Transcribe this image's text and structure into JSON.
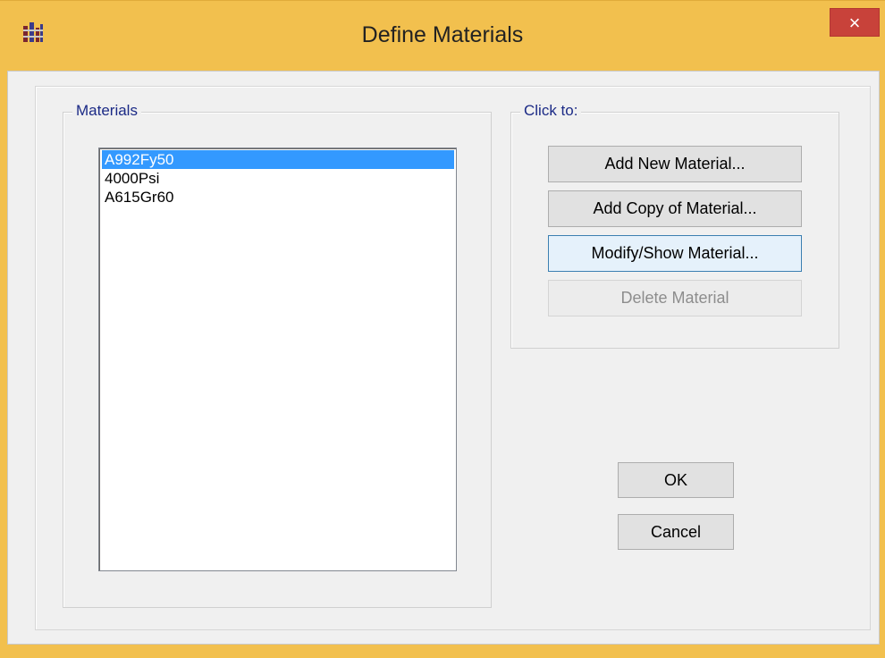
{
  "window": {
    "title": "Define Materials",
    "close_label": "×"
  },
  "materials_group": {
    "legend": "Materials",
    "items": [
      "A992Fy50",
      "4000Psi",
      "A615Gr60"
    ],
    "selected_index": 0
  },
  "actions_group": {
    "legend": "Click to:",
    "add_new": "Add New Material...",
    "add_copy": "Add Copy of Material...",
    "modify_show": "Modify/Show Material...",
    "delete": "Delete Material"
  },
  "dialog_buttons": {
    "ok": "OK",
    "cancel": "Cancel"
  },
  "colors": {
    "selection": "#3399ff",
    "frame": "#f2c04e",
    "close_button": "#c8423a",
    "group_legend": "#1b2a86"
  },
  "icons": {
    "app": "app-icon",
    "close": "close-icon"
  }
}
